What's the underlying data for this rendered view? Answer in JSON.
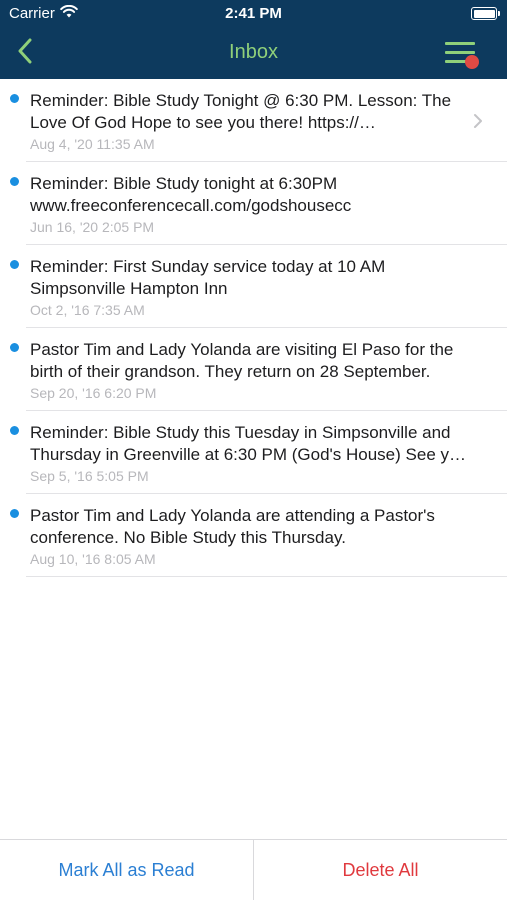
{
  "status_bar": {
    "carrier": "Carrier",
    "time": "2:41 PM",
    "icons": [
      "wifi-icon",
      "battery-icon"
    ]
  },
  "nav": {
    "title": "Inbox",
    "back_icon": "chevron-left-icon",
    "menu_icon": "hamburger-menu-icon",
    "has_notification": true
  },
  "colors": {
    "header_bg": "#0d3a5e",
    "accent_green": "#8fd07a",
    "unread_dot": "#1a8fe0",
    "link_blue": "#2b7fd3",
    "destructive_red": "#e0393e"
  },
  "messages": [
    {
      "text": "Reminder: Bible Study Tonight @ 6:30 PM.  Lesson: The Love Of God  Hope to see you there!  https://…",
      "date": "Aug 4, '20 11:35 AM",
      "unread": true,
      "has_chevron": true
    },
    {
      "text": "Reminder: Bible Study tonight at 6:30PM www.freeconferencecall.com/godshousecc",
      "date": "Jun 16, '20 2:05 PM",
      "unread": true,
      "has_chevron": false
    },
    {
      "text": "Reminder: First Sunday service today at 10 AM Simpsonville Hampton Inn",
      "date": "Oct 2, '16 7:35 AM",
      "unread": true,
      "has_chevron": false
    },
    {
      "text": "Pastor Tim and Lady Yolanda are visiting El Paso for the birth of their grandson.  They return on 28 September.",
      "date": "Sep 20, '16 6:20 PM",
      "unread": true,
      "has_chevron": false
    },
    {
      "text": "Reminder: Bible Study this Tuesday in Simpsonville and Thursday in Greenville at 6:30 PM (God's House)  See y…",
      "date": "Sep 5, '16 5:05 PM",
      "unread": true,
      "has_chevron": false
    },
    {
      "text": "Pastor Tim and Lady Yolanda are attending a Pastor's conference. No Bible Study this Thursday.",
      "date": "Aug 10, '16 8:05 AM",
      "unread": true,
      "has_chevron": false
    }
  ],
  "bottom_bar": {
    "mark_all_read": "Mark All as Read",
    "delete_all": "Delete All"
  }
}
